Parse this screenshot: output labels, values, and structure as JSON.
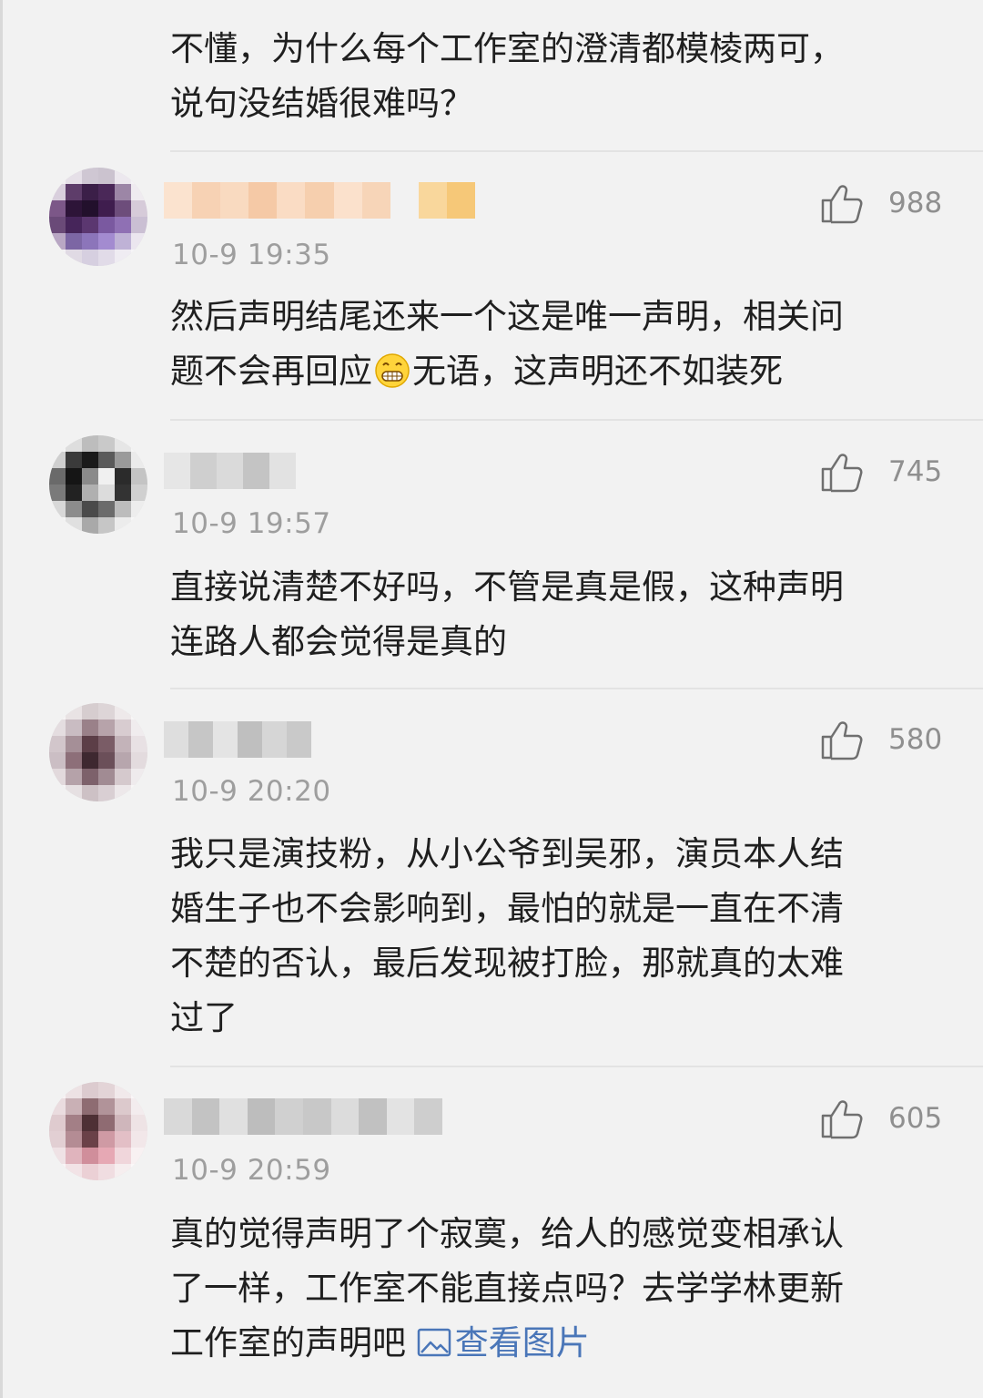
{
  "comments": [
    {
      "text": "不懂，为什么每个工作室的澄清都模棱两可，\n说句没结婚很难吗？"
    },
    {
      "timestamp": "10-9 19:35",
      "likes": "988",
      "text_before_emoji": "然后声明结尾还来一个这是唯一声明，相关问\n题不会再回应",
      "emoji": "grinning-face-icon",
      "text_after_emoji": "无语，这声明还不如装死"
    },
    {
      "timestamp": "10-9 19:57",
      "likes": "745",
      "text": "直接说清楚不好吗，不管是真是假，这种声明\n连路人都会觉得是真的"
    },
    {
      "timestamp": "10-9 20:20",
      "likes": "580",
      "text": "我只是演技粉，从小公爷到吴邪，演员本人结\n婚生子也不会影响到，最怕的就是一直在不清\n不楚的否认，最后发现被打脸，那就真的太难\n过了"
    },
    {
      "timestamp": "10-9 20:59",
      "likes": "605",
      "text": "真的觉得声明了个寂寞，给人的感觉变相承认\n了一样，工作室不能直接点吗？去学学林更新\n工作室的声明吧 ",
      "link_label": "查看图片",
      "link_icon": "image-icon"
    }
  ],
  "colors": {
    "background": "#f2f2f2",
    "text": "#1f1f1f",
    "meta": "#9e9e9e",
    "link": "#4a76b8"
  }
}
